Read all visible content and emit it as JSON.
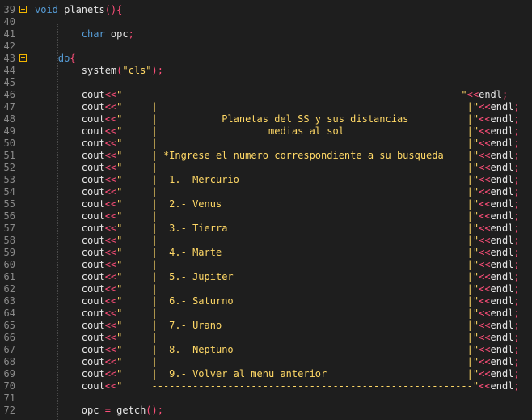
{
  "colors": {
    "background": "#1e1e1e",
    "keyword": "#569cd6",
    "string": "#ffd866",
    "operator": "#ff4f7a",
    "line_number": "#8a8a8a",
    "fold_marker": "#f2b600"
  },
  "lines": [
    {
      "n": "39",
      "tokens": [
        {
          "c": "kw",
          "t": "void "
        },
        {
          "c": "id",
          "t": "planets"
        },
        {
          "c": "pn",
          "t": "(){"
        }
      ]
    },
    {
      "n": "40",
      "tokens": []
    },
    {
      "n": "41",
      "tokens": [
        {
          "c": "sp",
          "t": "        "
        },
        {
          "c": "kw",
          "t": "char "
        },
        {
          "c": "id",
          "t": "opc"
        },
        {
          "c": "pn",
          "t": ";"
        }
      ]
    },
    {
      "n": "42",
      "tokens": []
    },
    {
      "n": "43",
      "tokens": [
        {
          "c": "sp",
          "t": "    "
        },
        {
          "c": "kw",
          "t": "do"
        },
        {
          "c": "pn",
          "t": "{"
        }
      ]
    },
    {
      "n": "44",
      "tokens": [
        {
          "c": "sp",
          "t": "        "
        },
        {
          "c": "id",
          "t": "system"
        },
        {
          "c": "pn",
          "t": "("
        },
        {
          "c": "str",
          "t": "\"cls\""
        },
        {
          "c": "pn",
          "t": ");"
        }
      ]
    },
    {
      "n": "45",
      "tokens": []
    },
    {
      "n": "46",
      "tokens": [
        {
          "c": "sp",
          "t": "        "
        },
        {
          "c": "id",
          "t": "cout"
        },
        {
          "c": "op",
          "t": "<<"
        },
        {
          "c": "str",
          "t": "\"     _____________________________________________________\""
        },
        {
          "c": "op",
          "t": "<<"
        },
        {
          "c": "id",
          "t": "endl"
        },
        {
          "c": "pn",
          "t": ";"
        }
      ]
    },
    {
      "n": "47",
      "tokens": [
        {
          "c": "sp",
          "t": "        "
        },
        {
          "c": "id",
          "t": "cout"
        },
        {
          "c": "op",
          "t": "<<"
        },
        {
          "c": "str",
          "t": "\"     |                                                     |\""
        },
        {
          "c": "op",
          "t": "<<"
        },
        {
          "c": "id",
          "t": "endl"
        },
        {
          "c": "pn",
          "t": ";"
        }
      ]
    },
    {
      "n": "48",
      "tokens": [
        {
          "c": "sp",
          "t": "        "
        },
        {
          "c": "id",
          "t": "cout"
        },
        {
          "c": "op",
          "t": "<<"
        },
        {
          "c": "str",
          "t": "\"     |           Planetas del SS y sus distancias          |\""
        },
        {
          "c": "op",
          "t": "<<"
        },
        {
          "c": "id",
          "t": "endl"
        },
        {
          "c": "pn",
          "t": ";"
        }
      ]
    },
    {
      "n": "49",
      "tokens": [
        {
          "c": "sp",
          "t": "        "
        },
        {
          "c": "id",
          "t": "cout"
        },
        {
          "c": "op",
          "t": "<<"
        },
        {
          "c": "str",
          "t": "\"     |                   medias al sol                     |\""
        },
        {
          "c": "op",
          "t": "<<"
        },
        {
          "c": "id",
          "t": "endl"
        },
        {
          "c": "pn",
          "t": ";"
        }
      ]
    },
    {
      "n": "50",
      "tokens": [
        {
          "c": "sp",
          "t": "        "
        },
        {
          "c": "id",
          "t": "cout"
        },
        {
          "c": "op",
          "t": "<<"
        },
        {
          "c": "str",
          "t": "\"     |                                                     |\""
        },
        {
          "c": "op",
          "t": "<<"
        },
        {
          "c": "id",
          "t": "endl"
        },
        {
          "c": "pn",
          "t": ";"
        }
      ]
    },
    {
      "n": "51",
      "tokens": [
        {
          "c": "sp",
          "t": "        "
        },
        {
          "c": "id",
          "t": "cout"
        },
        {
          "c": "op",
          "t": "<<"
        },
        {
          "c": "str",
          "t": "\"     | *Ingrese el numero correspondiente a su busqueda    |\""
        },
        {
          "c": "op",
          "t": "<<"
        },
        {
          "c": "id",
          "t": "endl"
        },
        {
          "c": "pn",
          "t": ";"
        }
      ]
    },
    {
      "n": "52",
      "tokens": [
        {
          "c": "sp",
          "t": "        "
        },
        {
          "c": "id",
          "t": "cout"
        },
        {
          "c": "op",
          "t": "<<"
        },
        {
          "c": "str",
          "t": "\"     |                                                     |\""
        },
        {
          "c": "op",
          "t": "<<"
        },
        {
          "c": "id",
          "t": "endl"
        },
        {
          "c": "pn",
          "t": ";"
        }
      ]
    },
    {
      "n": "53",
      "tokens": [
        {
          "c": "sp",
          "t": "        "
        },
        {
          "c": "id",
          "t": "cout"
        },
        {
          "c": "op",
          "t": "<<"
        },
        {
          "c": "str",
          "t": "\"     |  1.- Mercurio                                       |\""
        },
        {
          "c": "op",
          "t": "<<"
        },
        {
          "c": "id",
          "t": "endl"
        },
        {
          "c": "pn",
          "t": ";"
        }
      ]
    },
    {
      "n": "54",
      "tokens": [
        {
          "c": "sp",
          "t": "        "
        },
        {
          "c": "id",
          "t": "cout"
        },
        {
          "c": "op",
          "t": "<<"
        },
        {
          "c": "str",
          "t": "\"     |                                                     |\""
        },
        {
          "c": "op",
          "t": "<<"
        },
        {
          "c": "id",
          "t": "endl"
        },
        {
          "c": "pn",
          "t": ";"
        }
      ]
    },
    {
      "n": "55",
      "tokens": [
        {
          "c": "sp",
          "t": "        "
        },
        {
          "c": "id",
          "t": "cout"
        },
        {
          "c": "op",
          "t": "<<"
        },
        {
          "c": "str",
          "t": "\"     |  2.- Venus                                          |\""
        },
        {
          "c": "op",
          "t": "<<"
        },
        {
          "c": "id",
          "t": "endl"
        },
        {
          "c": "pn",
          "t": ";"
        }
      ]
    },
    {
      "n": "56",
      "tokens": [
        {
          "c": "sp",
          "t": "        "
        },
        {
          "c": "id",
          "t": "cout"
        },
        {
          "c": "op",
          "t": "<<"
        },
        {
          "c": "str",
          "t": "\"     |                                                     |\""
        },
        {
          "c": "op",
          "t": "<<"
        },
        {
          "c": "id",
          "t": "endl"
        },
        {
          "c": "pn",
          "t": ";"
        }
      ]
    },
    {
      "n": "57",
      "tokens": [
        {
          "c": "sp",
          "t": "        "
        },
        {
          "c": "id",
          "t": "cout"
        },
        {
          "c": "op",
          "t": "<<"
        },
        {
          "c": "str",
          "t": "\"     |  3.- Tierra                                         |\""
        },
        {
          "c": "op",
          "t": "<<"
        },
        {
          "c": "id",
          "t": "endl"
        },
        {
          "c": "pn",
          "t": ";"
        }
      ]
    },
    {
      "n": "58",
      "tokens": [
        {
          "c": "sp",
          "t": "        "
        },
        {
          "c": "id",
          "t": "cout"
        },
        {
          "c": "op",
          "t": "<<"
        },
        {
          "c": "str",
          "t": "\"     |                                                     |\""
        },
        {
          "c": "op",
          "t": "<<"
        },
        {
          "c": "id",
          "t": "endl"
        },
        {
          "c": "pn",
          "t": ";"
        }
      ]
    },
    {
      "n": "59",
      "tokens": [
        {
          "c": "sp",
          "t": "        "
        },
        {
          "c": "id",
          "t": "cout"
        },
        {
          "c": "op",
          "t": "<<"
        },
        {
          "c": "str",
          "t": "\"     |  4.- Marte                                          |\""
        },
        {
          "c": "op",
          "t": "<<"
        },
        {
          "c": "id",
          "t": "endl"
        },
        {
          "c": "pn",
          "t": ";"
        }
      ]
    },
    {
      "n": "60",
      "tokens": [
        {
          "c": "sp",
          "t": "        "
        },
        {
          "c": "id",
          "t": "cout"
        },
        {
          "c": "op",
          "t": "<<"
        },
        {
          "c": "str",
          "t": "\"     |                                                     |\""
        },
        {
          "c": "op",
          "t": "<<"
        },
        {
          "c": "id",
          "t": "endl"
        },
        {
          "c": "pn",
          "t": ";"
        }
      ]
    },
    {
      "n": "61",
      "tokens": [
        {
          "c": "sp",
          "t": "        "
        },
        {
          "c": "id",
          "t": "cout"
        },
        {
          "c": "op",
          "t": "<<"
        },
        {
          "c": "str",
          "t": "\"     |  5.- Jupiter                                        |\""
        },
        {
          "c": "op",
          "t": "<<"
        },
        {
          "c": "id",
          "t": "endl"
        },
        {
          "c": "pn",
          "t": ";"
        }
      ]
    },
    {
      "n": "62",
      "tokens": [
        {
          "c": "sp",
          "t": "        "
        },
        {
          "c": "id",
          "t": "cout"
        },
        {
          "c": "op",
          "t": "<<"
        },
        {
          "c": "str",
          "t": "\"     |                                                     |\""
        },
        {
          "c": "op",
          "t": "<<"
        },
        {
          "c": "id",
          "t": "endl"
        },
        {
          "c": "pn",
          "t": ";"
        }
      ]
    },
    {
      "n": "63",
      "tokens": [
        {
          "c": "sp",
          "t": "        "
        },
        {
          "c": "id",
          "t": "cout"
        },
        {
          "c": "op",
          "t": "<<"
        },
        {
          "c": "str",
          "t": "\"     |  6.- Saturno                                        |\""
        },
        {
          "c": "op",
          "t": "<<"
        },
        {
          "c": "id",
          "t": "endl"
        },
        {
          "c": "pn",
          "t": ";"
        }
      ]
    },
    {
      "n": "64",
      "tokens": [
        {
          "c": "sp",
          "t": "        "
        },
        {
          "c": "id",
          "t": "cout"
        },
        {
          "c": "op",
          "t": "<<"
        },
        {
          "c": "str",
          "t": "\"     |                                                     |\""
        },
        {
          "c": "op",
          "t": "<<"
        },
        {
          "c": "id",
          "t": "endl"
        },
        {
          "c": "pn",
          "t": ";"
        }
      ]
    },
    {
      "n": "65",
      "tokens": [
        {
          "c": "sp",
          "t": "        "
        },
        {
          "c": "id",
          "t": "cout"
        },
        {
          "c": "op",
          "t": "<<"
        },
        {
          "c": "str",
          "t": "\"     |  7.- Urano                                          |\""
        },
        {
          "c": "op",
          "t": "<<"
        },
        {
          "c": "id",
          "t": "endl"
        },
        {
          "c": "pn",
          "t": ";"
        }
      ]
    },
    {
      "n": "66",
      "tokens": [
        {
          "c": "sp",
          "t": "        "
        },
        {
          "c": "id",
          "t": "cout"
        },
        {
          "c": "op",
          "t": "<<"
        },
        {
          "c": "str",
          "t": "\"     |                                                     |\""
        },
        {
          "c": "op",
          "t": "<<"
        },
        {
          "c": "id",
          "t": "endl"
        },
        {
          "c": "pn",
          "t": ";"
        }
      ]
    },
    {
      "n": "67",
      "tokens": [
        {
          "c": "sp",
          "t": "        "
        },
        {
          "c": "id",
          "t": "cout"
        },
        {
          "c": "op",
          "t": "<<"
        },
        {
          "c": "str",
          "t": "\"     |  8.- Neptuno                                        |\""
        },
        {
          "c": "op",
          "t": "<<"
        },
        {
          "c": "id",
          "t": "endl"
        },
        {
          "c": "pn",
          "t": ";"
        }
      ]
    },
    {
      "n": "68",
      "tokens": [
        {
          "c": "sp",
          "t": "        "
        },
        {
          "c": "id",
          "t": "cout"
        },
        {
          "c": "op",
          "t": "<<"
        },
        {
          "c": "str",
          "t": "\"     |                                                     |\""
        },
        {
          "c": "op",
          "t": "<<"
        },
        {
          "c": "id",
          "t": "endl"
        },
        {
          "c": "pn",
          "t": ";"
        }
      ]
    },
    {
      "n": "69",
      "tokens": [
        {
          "c": "sp",
          "t": "        "
        },
        {
          "c": "id",
          "t": "cout"
        },
        {
          "c": "op",
          "t": "<<"
        },
        {
          "c": "str",
          "t": "\"     |  9.- Volver al menu anterior                        |\""
        },
        {
          "c": "op",
          "t": "<<"
        },
        {
          "c": "id",
          "t": "endl"
        },
        {
          "c": "pn",
          "t": ";"
        }
      ]
    },
    {
      "n": "70",
      "tokens": [
        {
          "c": "sp",
          "t": "        "
        },
        {
          "c": "id",
          "t": "cout"
        },
        {
          "c": "op",
          "t": "<<"
        },
        {
          "c": "str",
          "t": "\"     -------------------------------------------------------\""
        },
        {
          "c": "op",
          "t": "<<"
        },
        {
          "c": "id",
          "t": "endl"
        },
        {
          "c": "pn",
          "t": ";"
        }
      ]
    },
    {
      "n": "71",
      "tokens": []
    },
    {
      "n": "72",
      "tokens": [
        {
          "c": "sp",
          "t": "        "
        },
        {
          "c": "id",
          "t": "opc"
        },
        {
          "c": "op",
          "t": " = "
        },
        {
          "c": "id",
          "t": "getch"
        },
        {
          "c": "pn",
          "t": "();"
        }
      ]
    }
  ]
}
